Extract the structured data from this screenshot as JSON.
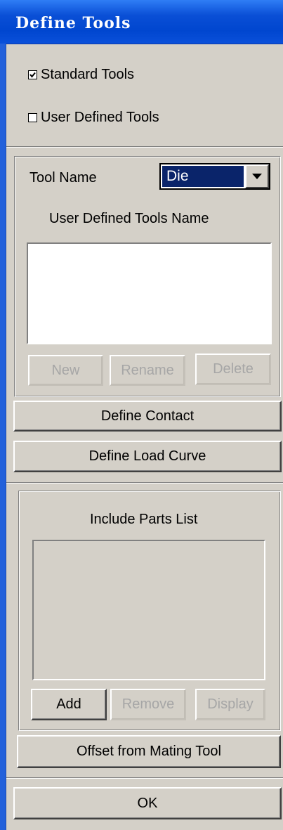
{
  "window": {
    "title": "Define Tools"
  },
  "checks": {
    "standard": {
      "label": "Standard Tools",
      "checked": true
    },
    "user_defined": {
      "label": "User Defined Tools",
      "checked": false
    }
  },
  "tools": {
    "tool_name_label": "Tool Name",
    "tool_name_value": "Die",
    "list_label": "User Defined Tools Name",
    "new_label": "New",
    "rename_label": "Rename",
    "delete_label": "Delete"
  },
  "actions": {
    "define_contact": "Define Contact",
    "define_load_curve": "Define Load Curve"
  },
  "parts": {
    "list_label": "Include Parts List",
    "add_label": "Add",
    "remove_label": "Remove",
    "display_label": "Display"
  },
  "offset_label": "Offset from Mating Tool",
  "ok_label": "OK"
}
